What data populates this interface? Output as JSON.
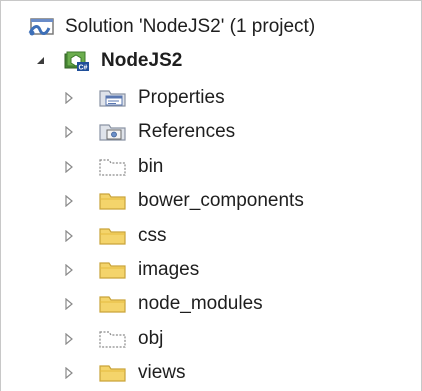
{
  "solution": {
    "label": "Solution 'NodeJS2' (1 project)",
    "icon": "solution-icon"
  },
  "project": {
    "label": "NodeJS2",
    "icon": "nodejs-project-icon",
    "expanded": true
  },
  "items": [
    {
      "label": "Properties",
      "icon": "properties-icon"
    },
    {
      "label": "References",
      "icon": "references-icon"
    },
    {
      "label": "bin",
      "icon": "folder-excluded-icon"
    },
    {
      "label": "bower_components",
      "icon": "folder-icon"
    },
    {
      "label": "css",
      "icon": "folder-icon"
    },
    {
      "label": "images",
      "icon": "folder-icon"
    },
    {
      "label": "node_modules",
      "icon": "folder-icon"
    },
    {
      "label": "obj",
      "icon": "folder-excluded-icon"
    },
    {
      "label": "views",
      "icon": "folder-icon"
    }
  ],
  "colors": {
    "folder_fill": "#f4d46b",
    "folder_stroke": "#c9a43a",
    "arrow": "#8a8a8a",
    "text": "#1e1e1e"
  }
}
